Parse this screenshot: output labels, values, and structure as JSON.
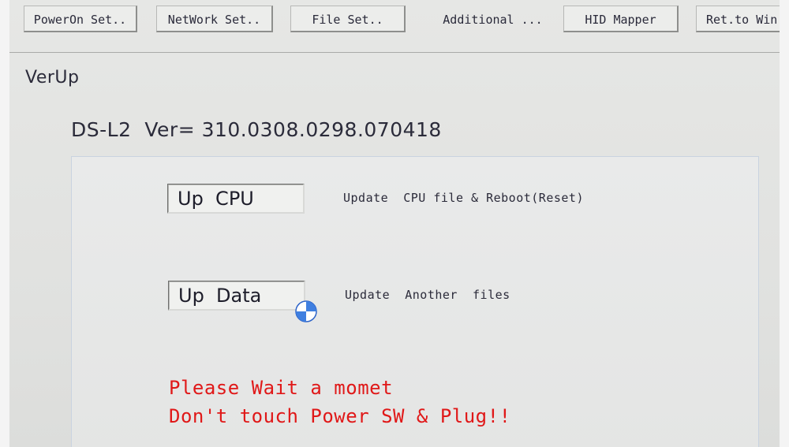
{
  "toolbar": {
    "poweron": "PowerOn Set..",
    "network": "NetWork Set..",
    "file": "File Set..",
    "additional": "Additional ...",
    "hid": "HID Mapper",
    "ret": "Ret.to Win"
  },
  "page": {
    "title": "VerUp",
    "version": "DS-L2  Ver= 310.0308.0298.070418"
  },
  "actions": [
    {
      "button": "Up  CPU",
      "description": "Update  CPU file & Reboot(Reset)"
    },
    {
      "button": "Up  Data",
      "description": "Update  Another  files"
    }
  ],
  "warning": {
    "line1": "Please Wait a momet",
    "line2": "Don't touch Power SW & Plug!!"
  },
  "colors": {
    "warning": "#e01818",
    "background": "#e2e3e1",
    "cursor_accent": "#3f7fe0"
  },
  "icons": {
    "cursor": "busy-cursor-icon"
  }
}
